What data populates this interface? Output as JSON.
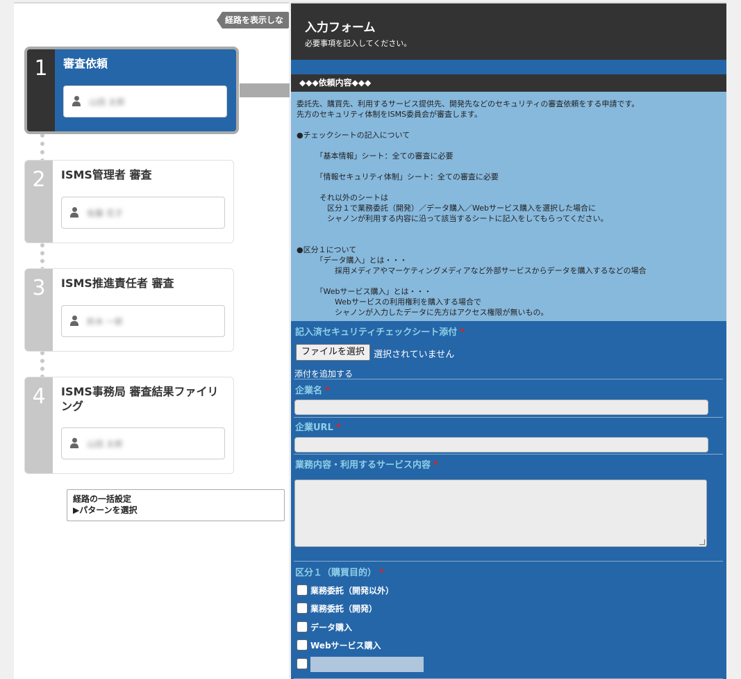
{
  "route_toggle": {
    "label": "経路を表示しない"
  },
  "steps": [
    {
      "number": "1",
      "title": "審査依頼",
      "user": "山田 太郎"
    },
    {
      "number": "2",
      "title": "ISMS管理者 審査",
      "user": "佐藤 花子"
    },
    {
      "number": "3",
      "title": "ISMS推進責任者 審査",
      "user": "鈴木 一郎"
    },
    {
      "number": "4",
      "title": "ISMS事務局 審査結果ファイリング",
      "user": "山田 太郎"
    }
  ],
  "route_pattern": {
    "line1": "経路の一括設定",
    "line2": "▶パターンを選択"
  },
  "form": {
    "title": "入力フォーム",
    "subtitle": "必要事項を記入してください。",
    "section_heading": "◆◆◆依頼内容◆◆◆",
    "description": "委託先、購買先、利用するサービス提供先、開発先などのセキュリティの審査依頼をする申請です。\n先方のセキュリティ体制をISMS委員会が審査します。\n\n●チェックシートの記入について\n\n　　　「基本情報」シート：全ての審査に必要\n\n　　　「情報セキュリティ体制」シート：全ての審査に必要\n\n　　　それ以外のシートは\n　　　　区分１で業務委託（開発）／データ購入／Webサービス購入を選択した場合に\n　　　　シャノンが利用する内容に沿って該当するシートに記入をしてもらってください。\n\n\n●区分１について\n　　　「データ購入」とは・・・\n　　　　　採用メディアやマーケティングメディアなど外部サービスからデータを購入するなどの場合\n\n　　　「Webサービス購入」とは・・・\n　　　　　Webサービスの利用権利を購入する場合で\n　　　　　シャノンが入力したデータに先方はアクセス権限が無いもの。",
    "attachment_label": "記入済セキュリティチェックシート添付",
    "file_button": "ファイルを選択",
    "file_status": "選択されていません",
    "add_attachment": "添付を追加する",
    "company_label": "企業名",
    "company_value": "",
    "url_label": "企業URL",
    "url_value": "",
    "business_label": "業務内容・利用するサービス内容",
    "category_label": "区分１（購買目的）",
    "categories": [
      "業務委託（開発以外）",
      "業務委託（開発）",
      "データ購入",
      "Webサービス購入"
    ],
    "required_mark": "*"
  },
  "colors": {
    "accent": "#2566a8",
    "header": "#333333",
    "desc_bg": "#87b9dd",
    "label": "#8fd0e8",
    "required": "#e02020"
  }
}
